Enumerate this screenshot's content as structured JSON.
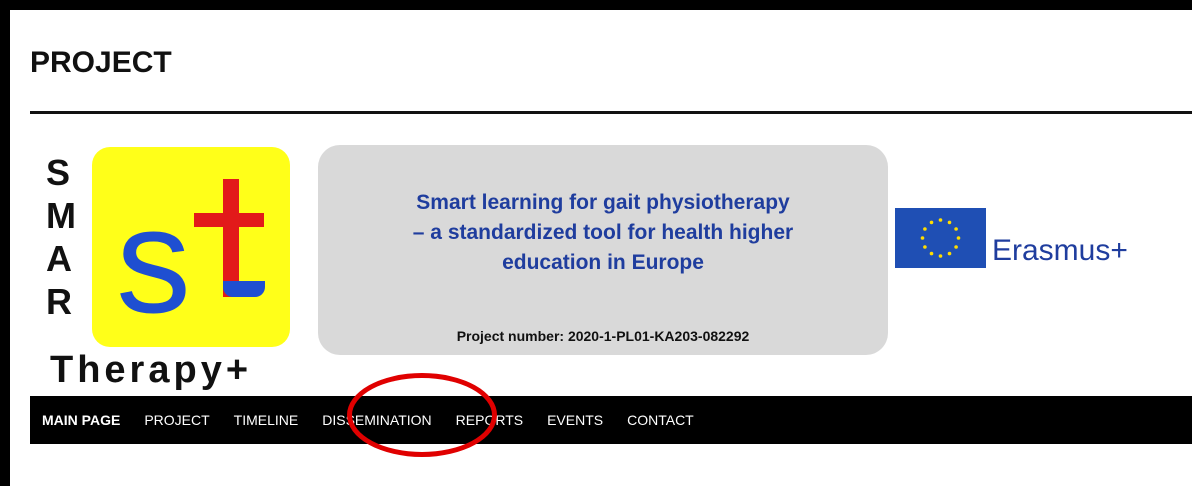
{
  "page": {
    "heading": "PROJECT"
  },
  "logo": {
    "letters": [
      "S",
      "M",
      "A",
      "R"
    ],
    "square_colors": {
      "background": "#ffff19",
      "s": "#1f4fd1",
      "t": "#e21a1a"
    },
    "s_glyph": "s",
    "therapy_text": "Therapy+"
  },
  "banner": {
    "title": "Smart learning for gait physiotherapy\n– a standardized tool for health higher\neducation in Europe",
    "project_number": "Project number: 2020-1-PL01-KA203-082292"
  },
  "erasmus": {
    "label": "Erasmus+",
    "flag_icon": "eu-flag-icon"
  },
  "nav": {
    "items": [
      {
        "label": "MAIN PAGE",
        "active": true
      },
      {
        "label": "PROJECT",
        "active": false
      },
      {
        "label": "TIMELINE",
        "active": false
      },
      {
        "label": "DISSEMINATION",
        "active": false
      },
      {
        "label": "REPORTS",
        "active": false
      },
      {
        "label": "EVENTS",
        "active": false
      },
      {
        "label": "CONTACT",
        "active": false
      }
    ]
  },
  "annotation": {
    "highlight_color": "#e00000"
  }
}
